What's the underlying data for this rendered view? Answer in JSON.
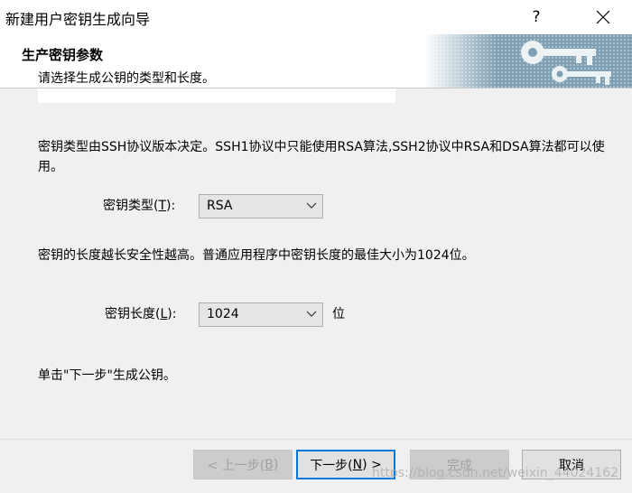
{
  "window": {
    "title": "新建用户密钥生成向导",
    "help_label": "?"
  },
  "header": {
    "title": "生产密钥参数",
    "subtitle": "请选择生成公钥的类型和长度。"
  },
  "body": {
    "type_description": "密钥类型由SSH协议版本决定。SSH1协议中只能使用RSA算法,SSH2协议中RSA和DSA算法都可以使用。",
    "type_label": "密钥类型(",
    "type_key": "T",
    "type_label_end": "):",
    "type_value": "RSA",
    "length_description": "密钥的长度越长安全性越高。普通应用程序中密钥长度的最佳大小为1024位。",
    "length_label": "密钥长度(",
    "length_key": "L",
    "length_label_end": "):",
    "length_value": "1024",
    "length_unit": "位",
    "instruction": "单击\"下一步\"生成公钥。"
  },
  "buttons": {
    "back": "< 上一步(",
    "back_key": "B",
    "back_end": ")",
    "next": "下一步(",
    "next_key": "N",
    "next_end": ") >",
    "finish": "完成",
    "cancel": "取消"
  },
  "watermark": "https://blog.csdn.net/weixin_44024162",
  "colors": {
    "accent": "#0078d7",
    "background": "#f0f0f0"
  }
}
